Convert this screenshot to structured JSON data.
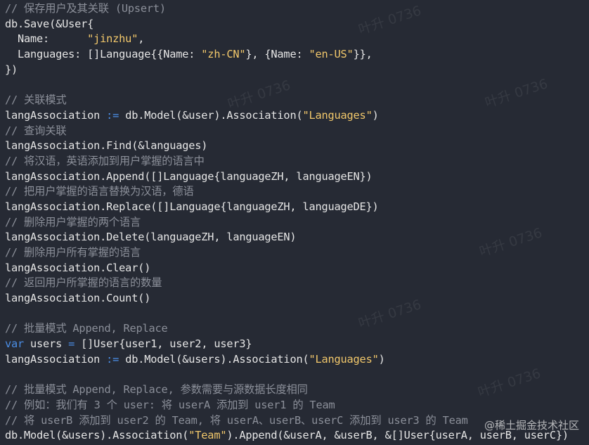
{
  "colors": {
    "background": "#262a34",
    "text": "#e6e6e6",
    "comment": "#8b8f99",
    "string": "#f2c86b",
    "keyword": "#4b8fe8"
  },
  "code_lines": [
    [
      {
        "t": "comment",
        "v": "// 保存用户及其关联 (Upsert)"
      }
    ],
    [
      {
        "t": "plain",
        "v": "db.Save(&User{"
      }
    ],
    [
      {
        "t": "plain",
        "v": "  Name:      "
      },
      {
        "t": "string",
        "v": "\"jinzhu\""
      },
      {
        "t": "plain",
        "v": ","
      }
    ],
    [
      {
        "t": "plain",
        "v": "  Languages: []Language{{Name: "
      },
      {
        "t": "string",
        "v": "\"zh-CN\""
      },
      {
        "t": "plain",
        "v": "}, {Name: "
      },
      {
        "t": "string",
        "v": "\"en-US\""
      },
      {
        "t": "plain",
        "v": "}},"
      }
    ],
    [
      {
        "t": "plain",
        "v": "})"
      }
    ],
    [],
    [
      {
        "t": "comment",
        "v": "// 关联模式"
      }
    ],
    [
      {
        "t": "plain",
        "v": "langAssociation "
      },
      {
        "t": "op",
        "v": ":="
      },
      {
        "t": "plain",
        "v": " db.Model(&user).Association("
      },
      {
        "t": "string",
        "v": "\"Languages\""
      },
      {
        "t": "plain",
        "v": ")"
      }
    ],
    [
      {
        "t": "comment",
        "v": "// 查询关联"
      }
    ],
    [
      {
        "t": "plain",
        "v": "langAssociation.Find(&languages)"
      }
    ],
    [
      {
        "t": "comment",
        "v": "// 将汉语，英语添加到用户掌握的语言中"
      }
    ],
    [
      {
        "t": "plain",
        "v": "langAssociation.Append([]Language{languageZH, languageEN})"
      }
    ],
    [
      {
        "t": "comment",
        "v": "// 把用户掌握的语言替换为汉语，德语"
      }
    ],
    [
      {
        "t": "plain",
        "v": "langAssociation.Replace([]Language{languageZH, languageDE})"
      }
    ],
    [
      {
        "t": "comment",
        "v": "// 删除用户掌握的两个语言"
      }
    ],
    [
      {
        "t": "plain",
        "v": "langAssociation.Delete(languageZH, languageEN)"
      }
    ],
    [
      {
        "t": "comment",
        "v": "// 删除用户所有掌握的语言"
      }
    ],
    [
      {
        "t": "plain",
        "v": "langAssociation.Clear()"
      }
    ],
    [
      {
        "t": "comment",
        "v": "// 返回用户所掌握的语言的数量"
      }
    ],
    [
      {
        "t": "plain",
        "v": "langAssociation.Count()"
      }
    ],
    [],
    [
      {
        "t": "comment",
        "v": "// 批量模式 Append, Replace"
      }
    ],
    [
      {
        "t": "keyword",
        "v": "var"
      },
      {
        "t": "plain",
        "v": " users "
      },
      {
        "t": "op",
        "v": "="
      },
      {
        "t": "plain",
        "v": " []User{user1, user2, user3}"
      }
    ],
    [
      {
        "t": "plain",
        "v": "langAssociation "
      },
      {
        "t": "op",
        "v": ":="
      },
      {
        "t": "plain",
        "v": " db.Model(&users).Association("
      },
      {
        "t": "string",
        "v": "\"Languages\""
      },
      {
        "t": "plain",
        "v": ")"
      }
    ],
    [],
    [
      {
        "t": "comment",
        "v": "// 批量模式 Append, Replace, 参数需要与源数据长度相同"
      }
    ],
    [
      {
        "t": "comment",
        "v": "// 例如：我们有 3 个 user: 将 userA 添加到 user1 的 Team"
      }
    ],
    [
      {
        "t": "comment",
        "v": "// 将 userB 添加到 user2 的 Team, 将 userA、userB、userC 添加到 user3 的 Team"
      }
    ],
    [
      {
        "t": "plain",
        "v": "db.Model(&users).Association("
      },
      {
        "t": "string",
        "v": "\"Team\""
      },
      {
        "t": "plain",
        "v": ").Append(&userA, &userB, &[]User{userA, userB, userC})"
      }
    ]
  ],
  "watermark_text": "叶升 0736",
  "credit": "@稀土掘金技术社区"
}
